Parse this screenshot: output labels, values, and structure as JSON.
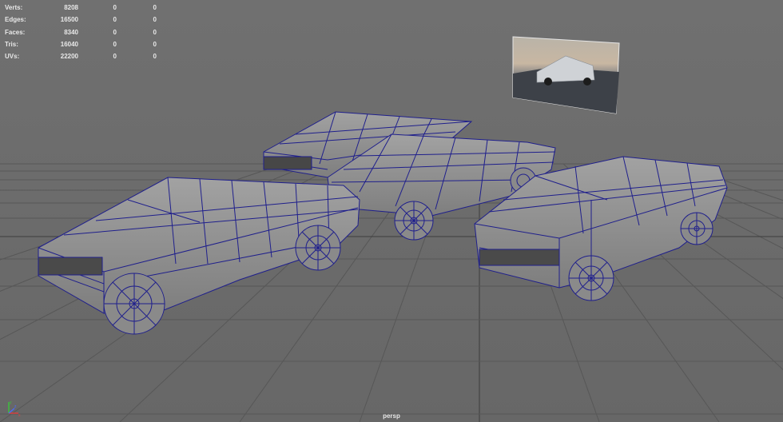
{
  "hud": {
    "rows": [
      {
        "label": "Verts:",
        "object": "8208",
        "selected": "0",
        "component": "0"
      },
      {
        "label": "Edges:",
        "object": "16500",
        "selected": "0",
        "component": "0"
      },
      {
        "label": "Faces:",
        "object": "8340",
        "selected": "0",
        "component": "0"
      },
      {
        "label": "Tris:",
        "object": "16040",
        "selected": "0",
        "component": "0"
      },
      {
        "label": "UVs:",
        "object": "22200",
        "selected": "0",
        "component": "0"
      }
    ]
  },
  "camera": {
    "name": "persp"
  },
  "axis": {
    "x": "x",
    "y": "y",
    "z": "z"
  },
  "colors": {
    "viewport_bg": "#6a6a6a",
    "grid": "#555555",
    "grid_center": "#3a3a3a",
    "wireframe": "#1f1f8c",
    "mesh_fill": "#8e8e8e",
    "hud_text": "#e8e8e8"
  }
}
